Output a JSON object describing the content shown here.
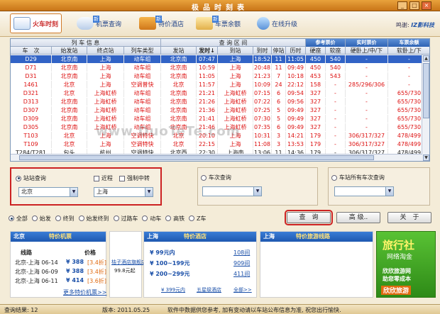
{
  "window": {
    "title": "极品时刻表",
    "min": "_",
    "max": "□",
    "close": "×"
  },
  "toolbar": {
    "tabs": [
      {
        "label": "火车时刻",
        "new": ""
      },
      {
        "label": "机票查询",
        "new": "新"
      },
      {
        "label": "特价酒店",
        "new": "新"
      },
      {
        "label": "车票余额",
        "new": "新"
      },
      {
        "label": "在线升级",
        "new": ""
      }
    ],
    "sponsor_label": "鸣谢:",
    "sponsor_logo": "IZ影科技"
  },
  "table": {
    "group_headers": [
      "列 车 信 息",
      "查 询 区 间",
      "参考票价",
      "实时票价",
      "车票余额"
    ],
    "columns": [
      "车　次",
      "始发站",
      "终点站",
      "列车类型",
      "发站",
      "发时",
      "到站",
      "到时",
      "停站",
      "历时",
      "硬座",
      "软座",
      "硬卧上/中/下",
      "软卧上/下"
    ],
    "sort_indicator": "↓",
    "rows": [
      [
        "D29",
        "北京南",
        "上海",
        "动车组",
        "北京南",
        "07:47",
        "上海",
        "18:52",
        "11",
        "11:05",
        "450",
        "540",
        "-",
        "-"
      ],
      [
        "D71",
        "北京南",
        "上海",
        "动车组",
        "北京南",
        "10:59",
        "上海",
        "20:48",
        "11",
        "09:49",
        "450",
        "540",
        "-",
        "-"
      ],
      [
        "D31",
        "北京南",
        "上海",
        "动车组",
        "北京南",
        "11:05",
        "上海",
        "21:23",
        "7",
        "10:18",
        "453",
        "543",
        "-",
        "-"
      ],
      [
        "1461",
        "北京",
        "上海",
        "空调普快",
        "北京",
        "11:57",
        "上海",
        "10:09",
        "24",
        "22:12",
        "158",
        "-",
        "285/296/306",
        "-"
      ],
      [
        "D321",
        "北京",
        "上海虹桥",
        "动车组",
        "北京南",
        "21:21",
        "上海虹桥",
        "07:15",
        "6",
        "09:54",
        "327",
        "-",
        "-",
        "655/730"
      ],
      [
        "D313",
        "北京南",
        "上海虹桥",
        "动车组",
        "北京南",
        "21:26",
        "上海虹桥",
        "07:22",
        "6",
        "09:56",
        "327",
        "-",
        "-",
        "655/730"
      ],
      [
        "D307",
        "北京南",
        "上海虹桥",
        "动车组",
        "北京南",
        "21:36",
        "上海虹桥",
        "07:25",
        "5",
        "09:49",
        "327",
        "-",
        "-",
        "655/730"
      ],
      [
        "D309",
        "北京南",
        "上海虹桥",
        "动车组",
        "北京南",
        "21:41",
        "上海虹桥",
        "07:30",
        "5",
        "09:49",
        "327",
        "-",
        "-",
        "655/730"
      ],
      [
        "D305",
        "北京南",
        "上海虹桥",
        "动车组",
        "北京南",
        "21:46",
        "上海虹桥",
        "07:35",
        "6",
        "09:49",
        "327",
        "-",
        "-",
        "655/730"
      ],
      [
        "T103",
        "北京",
        "上海",
        "空调特快",
        "北京",
        "20:10",
        "上海",
        "10:31",
        "3",
        "14:21",
        "179",
        "-",
        "306/317/327",
        "478/499"
      ],
      [
        "T109",
        "北京",
        "上海",
        "空调特快",
        "北京",
        "22:15",
        "上海",
        "11:08",
        "3",
        "13:53",
        "179",
        "-",
        "306/317/327",
        "478/499"
      ],
      [
        "T284/T281",
        "包头",
        "杭州",
        "空调特快",
        "北京西",
        "22:30",
        "上海南",
        "13:06",
        "11",
        "14:36",
        "179",
        "-",
        "306/317/327",
        "478/499"
      ]
    ]
  },
  "watermark": "www.DuoTeTe.com",
  "station_query": {
    "label": "站站查询",
    "checkbox_nearby": "近程",
    "checkbox_force_transfer": "强制中转",
    "from_value": "北京",
    "to_value": "上海"
  },
  "train_query": {
    "label": "车次查询",
    "value": ""
  },
  "station_all_query": {
    "label": "车站所有车次查询",
    "value": ""
  },
  "filters": [
    "全部",
    "始发",
    "终到",
    "始发终到",
    "过路车",
    "动车",
    "高铁",
    "Z车"
  ],
  "buttons": {
    "query": "查　询",
    "advanced": "高 级..",
    "about": "关　于"
  },
  "ads": {
    "flights": {
      "city": "北京",
      "title": "特价机票",
      "col_route": "线路",
      "col_price": "价格",
      "items": [
        {
          "route": "北京-上海 06-14",
          "price": "¥ 388",
          "disc": "[3.4折]"
        },
        {
          "route": "北京-上海 06-09",
          "price": "¥ 388",
          "disc": "[3.4折]"
        },
        {
          "route": "北京-上海 06-11",
          "price": "¥ 414",
          "disc": "[3.6折]"
        }
      ],
      "more": "更多特价机票>>"
    },
    "hotel_mini": {
      "name": "桔子酒店旗舰店",
      "price": "99.8元起"
    },
    "hotels": {
      "city": "上海",
      "title": "特价酒店",
      "items": [
        {
          "range": "¥ 99元内",
          "count": "108间"
        },
        {
          "range": "¥ 100~199元",
          "count": "909间"
        },
        {
          "range": "¥ 200~299元",
          "count": "411间"
        }
      ],
      "links": [
        "¥ 399元内",
        "五星级酒店",
        "全部>>"
      ]
    },
    "tours": {
      "city": "上海",
      "title": "特价旅游线路"
    },
    "travel": {
      "title": "旅行社",
      "subtitle": "网络淘金",
      "line1": "欣欣旅游网",
      "line2": "助您零成本",
      "brand": "欣欣旅游"
    }
  },
  "status": {
    "result": "查询结果:  12",
    "version": "版本:  2011.05.25",
    "notice": "软件中数据供您参考, 加有变动请以车站公布信息为准, 祝您出行愉快."
  }
}
